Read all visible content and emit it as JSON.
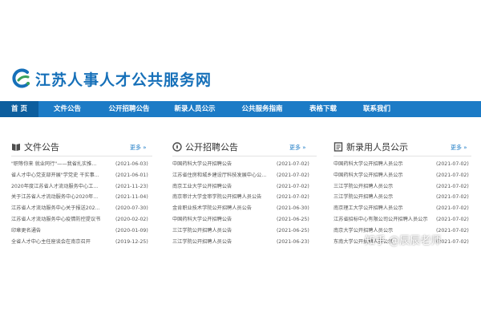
{
  "site": {
    "title": "江苏人事人才公共服务网"
  },
  "nav": {
    "items": [
      {
        "label": "首 页",
        "active": true
      },
      {
        "label": "文件公告",
        "active": false
      },
      {
        "label": "公开招聘公告",
        "active": false
      },
      {
        "label": "新录人员公示",
        "active": false
      },
      {
        "label": "公共服务指南",
        "active": false
      },
      {
        "label": "表格下载",
        "active": false
      },
      {
        "label": "联系我们",
        "active": false
      }
    ]
  },
  "sections": [
    {
      "title": "文件公告",
      "icon": "book-icon",
      "more": "更多 »",
      "items": [
        {
          "title": "\"职等你来 就业同行\"——我省扎实推...",
          "date": "(2021-06-03)"
        },
        {
          "title": "省人才中心党支部开展\"学党史 干实事...",
          "date": "(2021-06-01)"
        },
        {
          "title": "2020年度江苏省人才流动服务中心工...",
          "date": "(2021-11-23)"
        },
        {
          "title": "关于江苏省人才流动服务中心2020年...",
          "date": "(2021-11-04)"
        },
        {
          "title": "江苏省人才流动服务中心关于报送202...",
          "date": "(2020-07-30)"
        },
        {
          "title": "江苏省人才流动服务中心疫情防控提议书",
          "date": "(2020-02-02)"
        },
        {
          "title": "印章更名通告",
          "date": "(2020-01-09)"
        },
        {
          "title": "全省人才中心主任座谈会在南京召开",
          "date": "(2019-12-25)"
        }
      ]
    },
    {
      "title": "公开招聘公告",
      "icon": "compass-icon",
      "more": "更多 »",
      "items": [
        {
          "title": "中国药科大学公开招聘公告",
          "date": "(2021-07-02)"
        },
        {
          "title": "江苏省住房和城乡建设厅科技发展中心公...",
          "date": "(2021-07-02)"
        },
        {
          "title": "南京工业大学公开招聘公告",
          "date": "(2021-07-02)"
        },
        {
          "title": "南京审计大学金审学院公开招聘人员公告",
          "date": "(2021-07-02)"
        },
        {
          "title": "金肯职业技术学院公开招聘人员公告",
          "date": "(2021-06-30)"
        },
        {
          "title": "中国药科大学公开招聘公告",
          "date": "(2021-06-25)"
        },
        {
          "title": "三江学院公开招聘人员公告",
          "date": "(2021-06-25)"
        },
        {
          "title": "三江学院公开招聘人员公告",
          "date": "(2021-06-23)"
        }
      ]
    },
    {
      "title": "新录用人员公示",
      "icon": "document-icon",
      "more": "更多 »",
      "items": [
        {
          "title": "中国药科大学公开招聘人员公示",
          "date": "(2021-07-02)"
        },
        {
          "title": "中国药科大学公开招聘人员公示",
          "date": "(2021-07-02)"
        },
        {
          "title": "三江学院公开招聘人员公示",
          "date": "(2021-07-02)"
        },
        {
          "title": "三江学院公开招聘人员公示",
          "date": "(2021-07-02)"
        },
        {
          "title": "南京理工大学公开招聘人员公示",
          "date": "(2021-07-02)"
        },
        {
          "title": "江苏省招标中心有限公司公开招聘人员公示",
          "date": "(2021-07-02)"
        },
        {
          "title": "南京大学公开招聘人员公示",
          "date": "(2021-07-02)"
        },
        {
          "title": "东南大学公开招聘人员公示",
          "date": "(2021-07-02)"
        }
      ]
    }
  ],
  "watermark": {
    "text": "知乎 @辰辰老师"
  },
  "colors": {
    "brand": "#1670b9",
    "nav_bg": "#1c7bc6",
    "nav_active": "#0d5e9e",
    "logo_green": "#3aa15a"
  }
}
